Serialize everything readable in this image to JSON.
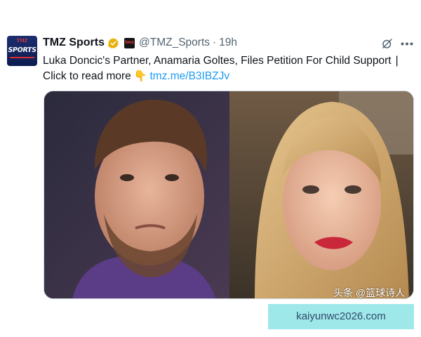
{
  "tweet": {
    "author_name": "TMZ Sports",
    "avatar_text_small": "TMZ",
    "avatar_text_main": "SPORTS",
    "affiliate_badge_text": "tmz",
    "handle": "@TMZ_Sports",
    "separator": "·",
    "time": "19h",
    "text_line1": "Luka Doncic's Partner, Anamaria Goltes, Files Petition For Child Support",
    "pipe": "|",
    "text_line2": "Click to read more",
    "pointer_emoji": "👇",
    "link": "tmz.me/B3IBZJv"
  },
  "icons": {
    "verified": "verified-badge-icon",
    "grok": "grok-icon",
    "more": "more-options-icon"
  },
  "source_badge": "头条 @篮球诗人",
  "watermark": "kaiyunwc2026.com",
  "colors": {
    "link": "#1d9bf0",
    "secondary_text": "#536471",
    "verified_gold": "#e8b10c",
    "watermark_bg": "#9fe8ea"
  }
}
